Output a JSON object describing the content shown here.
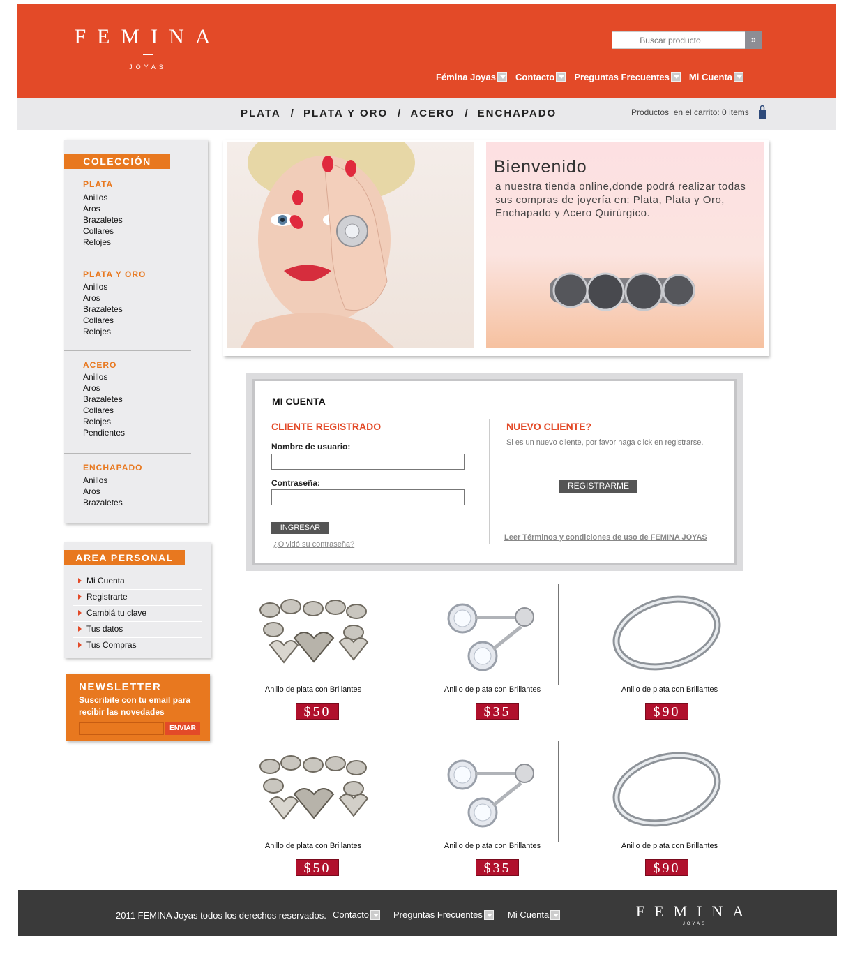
{
  "brand": {
    "name": "FEMINA",
    "sub": "JOYAS"
  },
  "search": {
    "placeholder": "Buscar producto",
    "button": "»"
  },
  "topnav": [
    {
      "label": "Fémina Joyas"
    },
    {
      "label": "Contacto"
    },
    {
      "label": "Preguntas Frecuentes"
    },
    {
      "label": "Mi Cuenta"
    }
  ],
  "categories": [
    "PLATA",
    "PLATA Y ORO",
    "ACERO",
    "ENCHAPADO"
  ],
  "category_sep": "/",
  "cart": {
    "text": "Productos  en el carrito: 0 items"
  },
  "sidebar": {
    "title": "COLECCIÓN",
    "groups": [
      {
        "title": "PLATA",
        "items": [
          "Anillos",
          "Aros",
          "Brazaletes",
          "Collares",
          "Relojes"
        ]
      },
      {
        "title": "PLATA Y ORO",
        "items": [
          "Anillos",
          "Aros",
          "Brazaletes",
          "Collares",
          "Relojes"
        ]
      },
      {
        "title": "ACERO",
        "items": [
          "Anillos",
          "Aros",
          "Brazaletes",
          "Collares",
          "Relojes",
          "Pendientes"
        ]
      },
      {
        "title": "ENCHAPADO",
        "items": [
          "Anillos",
          "Aros",
          "Brazaletes"
        ]
      }
    ]
  },
  "area_personal": {
    "title": "AREA PERSONAL",
    "items": [
      "Mi Cuenta",
      "Registrarte",
      "Cambiá tu clave",
      "Tus datos",
      "Tus Compras"
    ]
  },
  "newsletter": {
    "title": "NEWSLETTER",
    "text": "Suscribite con tu email para recibir las novedades",
    "button": "ENVIAR",
    "value": ""
  },
  "hero": {
    "title": "Bienvenido",
    "text": "a nuestra tienda online,donde podrá realizar todas sus compras de joyería en: Plata, Plata y Oro, Enchapado y Acero Quirúrgico."
  },
  "account": {
    "title": "MI CUENTA",
    "registered": {
      "title": "CLIENTE REGISTRADO",
      "user_label": "Nombre de usuario:",
      "user_value": "",
      "pass_label": "Contraseña:",
      "pass_value": "",
      "submit": "INGRESAR",
      "forgot": "¿Olvidó su contraseña?"
    },
    "new": {
      "title": "NUEVO CLIENTE?",
      "text": "Si es un nuevo cliente, por favor haga click en registrarse.",
      "button": "REGISTRARME",
      "terms": "Leer Términos y condiciones de uso de FEMINA JOYAS"
    }
  },
  "products": [
    {
      "name": "Anillo de plata con Brillantes",
      "price": "$50",
      "kind": "bracelet"
    },
    {
      "name": "Anillo de plata con Brillantes",
      "price": "$35",
      "kind": "earrings"
    },
    {
      "name": "Anillo de plata con Brillantes",
      "price": "$90",
      "kind": "ring"
    },
    {
      "name": "Anillo de plata con Brillantes",
      "price": "$50",
      "kind": "bracelet"
    },
    {
      "name": "Anillo de plata con Brillantes",
      "price": "$35",
      "kind": "earrings"
    },
    {
      "name": "Anillo de plata con Brillantes",
      "price": "$90",
      "kind": "ring"
    }
  ],
  "footer": {
    "copyright": "2011 FEMINA Joyas todos los derechos reservados.",
    "links": [
      "Contacto",
      "Preguntas Frecuentes",
      "Mi Cuenta"
    ],
    "brand": "FEMINA",
    "brand_sub": "JOYAS"
  },
  "colors": {
    "accent": "#e34a28",
    "orange": "#e8781f",
    "price": "#b0102c",
    "footer": "#3a3a3a"
  }
}
